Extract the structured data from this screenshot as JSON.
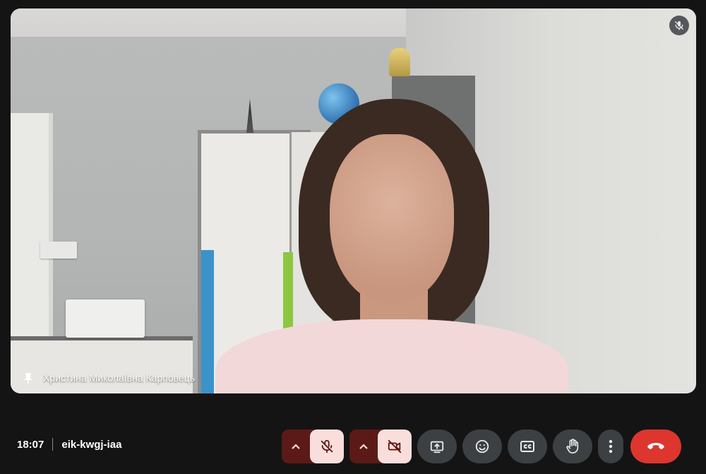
{
  "participant": {
    "name": "Христина Миколаївна Карповець",
    "muted": true,
    "pinned": true
  },
  "meeting": {
    "time": "18:07",
    "code": "eik-kwgj-iaa"
  },
  "controls": {
    "mic": {
      "state": "off",
      "icon": "mic-off-icon"
    },
    "camera": {
      "state": "off",
      "icon": "videocam-off-icon"
    },
    "present": {
      "icon": "present-screen-icon"
    },
    "reactions": {
      "icon": "emoji-icon"
    },
    "captions": {
      "icon": "closed-captions-icon"
    },
    "raise_hand": {
      "icon": "hand-icon"
    },
    "more": {
      "icon": "more-vert-icon"
    },
    "leave": {
      "icon": "call-end-icon"
    }
  },
  "colors": {
    "background": "#141414",
    "control": "#3c4043",
    "off_toggle": "#f9dedc",
    "off_toggle_dark": "#5b1a17",
    "leave": "#dc362e"
  }
}
